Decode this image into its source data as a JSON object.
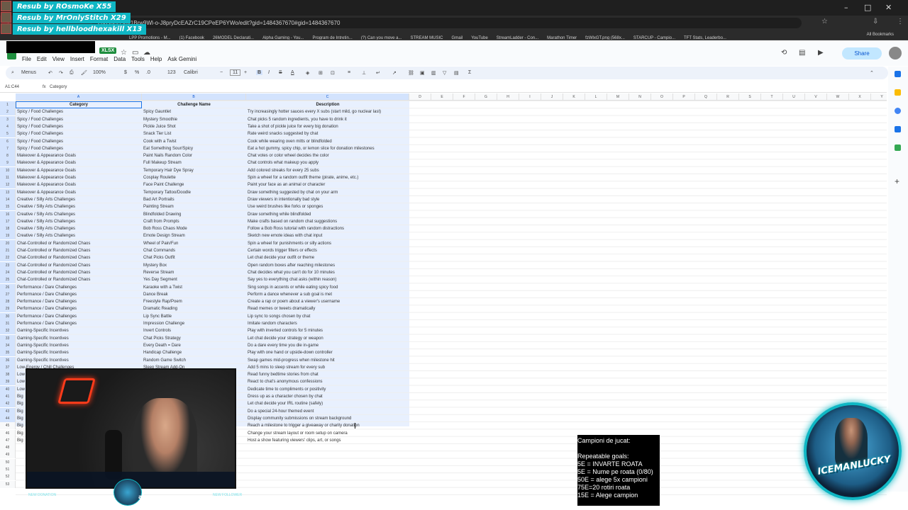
{
  "overlay": {
    "subs": [
      "Resub by ROsmoKe X55",
      "Resub by MrOnlyStitch X29",
      "Resub by hellbloodhexakill X13"
    ]
  },
  "browser": {
    "url": "eadsheets/d/1Brw9Wl-o-J8pryDcEAZrC19CPeEP6YWo/edit?gid=1484367670#gid=1484367670",
    "bookmarks": [
      "LPP Promotions - M...",
      "(1) Facebook",
      "26MODEL Declarati...",
      "Alpha Gaming - You...",
      "Program de Intretin...",
      "(?) Can you move a...",
      "STREAM MUSIC",
      "Gmail",
      "YouTube",
      "StreamLadder - Con...",
      "Marathon Timer",
      "fzWlxGT.png (568x...",
      "STARCUP - Campio...",
      "TFT Stats, Leaderbo..."
    ],
    "all_bookmarks": "All Bookmarks"
  },
  "sheets": {
    "file_badge": "XLSX",
    "menu": [
      "File",
      "Edit",
      "View",
      "Insert",
      "Format",
      "Data",
      "Tools",
      "Help",
      "Ask Gemini"
    ],
    "share": "Share",
    "toolbar": {
      "menus": "Menus",
      "zoom": "100%",
      "pct": "%",
      "dec": ".0",
      "num": "123",
      "font": "Calibri",
      "size": "11"
    },
    "namebox": "A1:C44",
    "formula": "Category"
  },
  "columns": [
    "A",
    "B",
    "C",
    "D",
    "E",
    "F",
    "G",
    "H",
    "I",
    "J",
    "K",
    "L",
    "M",
    "N",
    "O",
    "P",
    "Q",
    "R",
    "S",
    "T",
    "U",
    "V",
    "W",
    "X",
    "Y"
  ],
  "header": {
    "category": "Category",
    "challenge": "Challenge Name",
    "description": "Description"
  },
  "rows": [
    [
      "Spicy / Food Challenges",
      "Spicy Gauntlet",
      "Try increasingly hotter sauces every X subs (start mild, go nuclear last)"
    ],
    [
      "Spicy / Food Challenges",
      "Mystery Smoothie",
      "Chat picks 5 random ingredients, you have to drink it"
    ],
    [
      "Spicy / Food Challenges",
      "Pickle Juice Shot",
      "Take a shot of pickle juice for every big donation"
    ],
    [
      "Spicy / Food Challenges",
      "Snack Tier List",
      "Rate weird snacks suggested by chat"
    ],
    [
      "Spicy / Food Challenges",
      "Cook with a Twist",
      "Cook while wearing oven mitts or blindfolded"
    ],
    [
      "Spicy / Food Challenges",
      "Eat Something Sour/Spicy",
      "Eat a hot gummy, spicy chip, or lemon slice for donation milestones"
    ],
    [
      "Makeover & Appearance Goals",
      "Paint Nails Random Color",
      "Chat votes or color wheel decides the color"
    ],
    [
      "Makeover & Appearance Goals",
      "Full Makeup Stream",
      "Chat controls what makeup you apply"
    ],
    [
      "Makeover & Appearance Goals",
      "Temporary Hair Dye Spray",
      "Add colored streaks for every 25 subs"
    ],
    [
      "Makeover & Appearance Goals",
      "Cosplay Roulette",
      "Spin a wheel for a random outfit theme (pirate, anime, etc.)"
    ],
    [
      "Makeover & Appearance Goals",
      "Face Paint Challenge",
      "Paint your face as an animal or character"
    ],
    [
      "Makeover & Appearance Goals",
      "Temporary Tattoo/Doodle",
      "Draw something suggested by chat on your arm"
    ],
    [
      "Creative / Silly Arts Challenges",
      "Bad Art Portraits",
      "Draw viewers in intentionally bad style"
    ],
    [
      "Creative / Silly Arts Challenges",
      "Painting Stream",
      "Use weird brushes like forks or sponges"
    ],
    [
      "Creative / Silly Arts Challenges",
      "Blindfolded Drawing",
      "Draw something while blindfolded"
    ],
    [
      "Creative / Silly Arts Challenges",
      "Craft from Prompts",
      "Make crafts based on random chat suggestions"
    ],
    [
      "Creative / Silly Arts Challenges",
      "Bob Ross Chaos Mode",
      "Follow a Bob Ross tutorial with random distractions"
    ],
    [
      "Creative / Silly Arts Challenges",
      "Emote Design Stream",
      "Sketch new emote ideas with chat input"
    ],
    [
      "Chat-Controlled or Randomized Chaos",
      "Wheel of Pain/Fun",
      "Spin a wheel for punishments or silly actions"
    ],
    [
      "Chat-Controlled or Randomized Chaos",
      "Chat Commands",
      "Certain words trigger filters or effects"
    ],
    [
      "Chat-Controlled or Randomized Chaos",
      "Chat Picks Outfit",
      "Let chat decide your outfit or theme"
    ],
    [
      "Chat-Controlled or Randomized Chaos",
      "Mystery Box",
      "Open random boxes after reaching milestones"
    ],
    [
      "Chat-Controlled or Randomized Chaos",
      "Reverse Stream",
      "Chat decides what you can't do for 10 minutes"
    ],
    [
      "Chat-Controlled or Randomized Chaos",
      "Yes Day Segment",
      "Say yes to everything chat asks (within reason)"
    ],
    [
      "Performance / Dare Challenges",
      "Karaoke with a Twist",
      "Sing songs in accents or while eating spicy food"
    ],
    [
      "Performance / Dare Challenges",
      "Dance Break",
      "Perform a dance whenever a sub goal is met"
    ],
    [
      "Performance / Dare Challenges",
      "Freestyle Rap/Poem",
      "Create a rap or poem about a viewer's username"
    ],
    [
      "Performance / Dare Challenges",
      "Dramatic Reading",
      "Read memes or tweets dramatically"
    ],
    [
      "Performance / Dare Challenges",
      "Lip Sync Battle",
      "Lip sync to songs chosen by chat"
    ],
    [
      "Performance / Dare Challenges",
      "Impression Challenge",
      "Imitate random characters"
    ],
    [
      "Gaming-Specific Incentives",
      "Invert Controls",
      "Play with inverted controls for 5 minutes"
    ],
    [
      "Gaming-Specific Incentives",
      "Chat Picks Strategy",
      "Let chat decide your strategy or weapon"
    ],
    [
      "Gaming-Specific Incentives",
      "Every Death = Dare",
      "Do a dare every time you die in-game"
    ],
    [
      "Gaming-Specific Incentives",
      "Handicap Challenge",
      "Play with one hand or upside-down controller"
    ],
    [
      "Gaming-Specific Incentives",
      "Random Game Switch",
      "Swap games mid-progress when milestone hit"
    ],
    [
      "Low-Energy / Chill Challenges",
      "Sleep Stream Add-On",
      "Add 5 mins to sleep stream for every sub"
    ],
    [
      "Low",
      "",
      "Read funny bedtime stories from chat"
    ],
    [
      "Low",
      "",
      "React to chat's anonymous confessions"
    ],
    [
      "Low",
      "",
      "Dedicate time to compliments or positivity"
    ],
    [
      "Big",
      "",
      "Dress up as a character chosen by chat"
    ],
    [
      "Big",
      "",
      "Let chat decide your IRL routine (safely)"
    ],
    [
      "Big",
      "",
      "Do a special 24-hour themed event"
    ],
    [
      "Big",
      "",
      "Display community submissions on stream background"
    ],
    [
      "Big",
      "",
      "Reach a milestone to trigger a giveaway or charity donation"
    ],
    [
      "Big",
      "",
      "Change your stream layout or room setup on camera"
    ],
    [
      "Big",
      "",
      "Host a show featuring viewers' clips, art, or songs"
    ]
  ],
  "row_numbers": [
    "1",
    "2",
    "3",
    "4",
    "5",
    "6",
    "7",
    "8",
    "9",
    "10",
    "11",
    "12",
    "13",
    "14",
    "15",
    "16",
    "17",
    "18",
    "19",
    "20",
    "21",
    "22",
    "23",
    "24",
    "25",
    "26",
    "27",
    "28",
    "29",
    "30",
    "31",
    "32",
    "33",
    "34",
    "35",
    "36",
    "37",
    "38",
    "39",
    "40",
    "41",
    "42",
    "43",
    "44",
    "45",
    "46",
    "47",
    "48",
    "49",
    "50",
    "51",
    "52",
    "53"
  ],
  "webcam": {
    "name": "atucx",
    "tag_left": "NEW DONATION",
    "tag_right": "NEW FOLLOWER"
  },
  "goals": {
    "lines": [
      "Campioni de jucat:",
      "",
      "Repeatable goals:",
      "5E = INVARTE ROATA",
      "5E = Nume pe roata (0/80)",
      "50E = alege 5x campioni",
      "75E=20 rotiri roata",
      "15E = Alege campion"
    ]
  },
  "badge": {
    "text": "ICEMANLUCKY"
  },
  "colors": {
    "sheets_green": "#1e8e3e",
    "selection": "#e8f0fe",
    "overlay_teal": "#0fb7c4",
    "share_bg": "#c2e7ff"
  }
}
